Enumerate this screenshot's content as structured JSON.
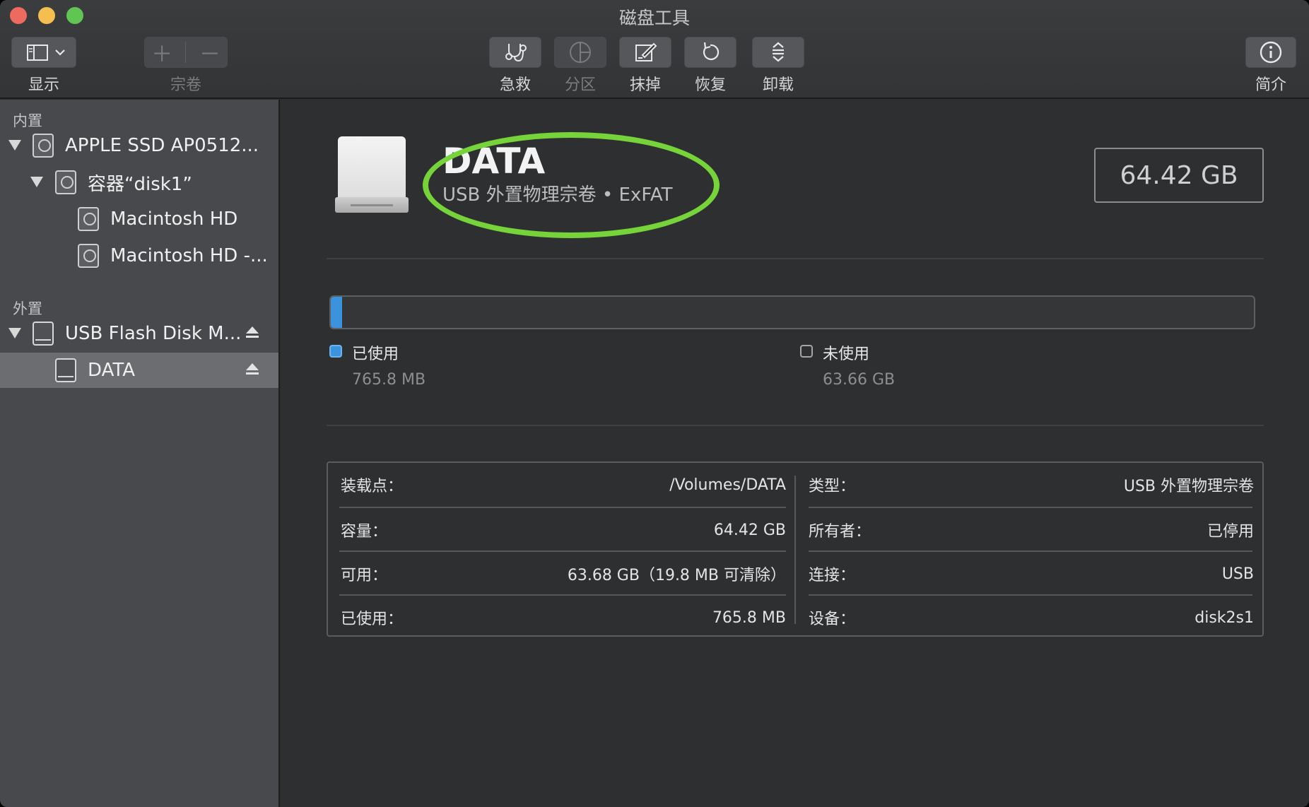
{
  "window": {
    "title": "磁盘工具"
  },
  "toolbar": {
    "view_label": "显示",
    "volume_label": "宗卷",
    "firstaid_label": "急救",
    "partition_label": "分区",
    "erase_label": "抹掉",
    "restore_label": "恢复",
    "unmount_label": "卸载",
    "info_label": "简介"
  },
  "sidebar": {
    "internal_header": "内置",
    "external_header": "外置",
    "items": [
      {
        "label": "APPLE SSD AP0512..."
      },
      {
        "label": "容器“disk1”"
      },
      {
        "label": "Macintosh HD"
      },
      {
        "label": "Macintosh HD -..."
      },
      {
        "label": "USB Flash Disk M..."
      },
      {
        "label": "DATA"
      }
    ]
  },
  "volume": {
    "name": "DATA",
    "subtitle": "USB 外置物理宗卷 • ExFAT",
    "capacity": "64.42 GB"
  },
  "usage": {
    "used_fraction": 0.012,
    "used_label": "已使用",
    "used_value": "765.8 MB",
    "free_label": "未使用",
    "free_value": "63.66 GB",
    "used_color": "#3a93dc"
  },
  "info": {
    "left": [
      {
        "key": "装载点：",
        "value": "/Volumes/DATA"
      },
      {
        "key": "容量：",
        "value": "64.42 GB"
      },
      {
        "key": "可用：",
        "value": "63.68 GB（19.8 MB 可清除）"
      },
      {
        "key": "已使用：",
        "value": "765.8 MB"
      }
    ],
    "right": [
      {
        "key": "类型：",
        "value": "USB 外置物理宗卷"
      },
      {
        "key": "所有者：",
        "value": "已停用"
      },
      {
        "key": "连接：",
        "value": "USB"
      },
      {
        "key": "设备：",
        "value": "disk2s1"
      }
    ]
  }
}
